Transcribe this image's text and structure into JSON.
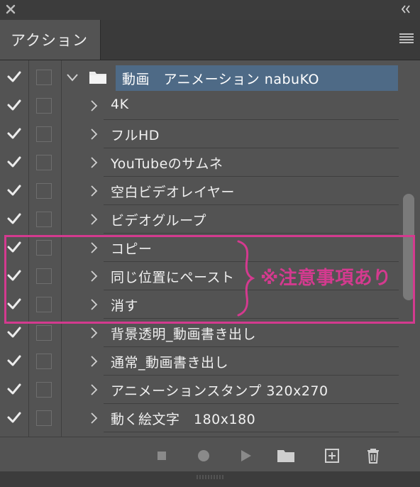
{
  "panel": {
    "tab_label": "アクション"
  },
  "actions": {
    "folder": {
      "label": "動画　アニメーション nabuKO",
      "expanded": true,
      "checked": true
    },
    "items": [
      {
        "label": "4K",
        "checked": true
      },
      {
        "label": "フルHD",
        "checked": true
      },
      {
        "label": "YouTubeのサムネ",
        "checked": true
      },
      {
        "label": "空白ビデオレイヤー",
        "checked": true
      },
      {
        "label": "ビデオグループ",
        "checked": true
      },
      {
        "label": "コピー",
        "checked": true
      },
      {
        "label": "同じ位置にペースト",
        "checked": true
      },
      {
        "label": "消す",
        "checked": true
      },
      {
        "label": "背景透明_動画書き出し",
        "checked": true
      },
      {
        "label": "通常_動画書き出し",
        "checked": true
      },
      {
        "label": "アニメーションスタンプ 320x270",
        "checked": true
      },
      {
        "label": "動く絵文字　180x180",
        "checked": true
      }
    ]
  },
  "annotation": {
    "text": "※注意事項あり",
    "color": "#d43a8f"
  },
  "colors": {
    "panel_bg": "#535353",
    "selection": "#4e6a86",
    "annotation": "#d43a8f"
  }
}
